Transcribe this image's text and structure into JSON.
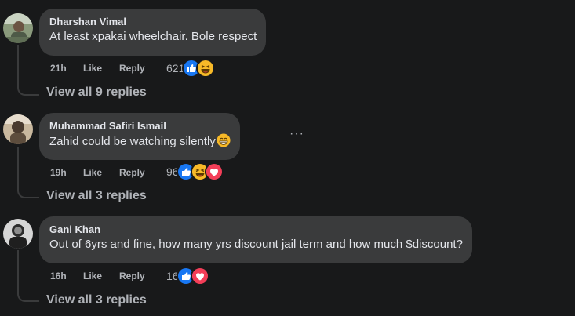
{
  "comments": [
    {
      "author": "Dharshan Vimal",
      "text": "At least xpakai wheelchair. Bole respect",
      "time": "21h",
      "like_label": "Like",
      "reply_label": "Reply",
      "reaction_count": "621",
      "reactions": [
        "like",
        "haha"
      ],
      "view_replies": "View all 9 replies"
    },
    {
      "author": "Muhammad Safiri Ismail",
      "text": "Zahid could be watching silently",
      "text_emoji": "grin",
      "more_label": "···",
      "time": "19h",
      "like_label": "Like",
      "reply_label": "Reply",
      "reaction_count": "96",
      "reactions": [
        "like",
        "haha",
        "love"
      ],
      "view_replies": "View all 3 replies"
    },
    {
      "author": "Gani Khan",
      "text": "Out of 6yrs and fine, how many yrs discount jail term and how much $discount?",
      "time": "16h",
      "like_label": "Like",
      "reply_label": "Reply",
      "reaction_count": "16",
      "reactions": [
        "like",
        "love"
      ],
      "view_replies": "View all 3 replies"
    }
  ],
  "colors": {
    "background": "#18191a",
    "bubble": "#3a3b3c",
    "primary_text": "#e4e6eb",
    "secondary_text": "#b0b3b8",
    "like_blue": "#1877f2",
    "love_red": "#f33e58",
    "haha_yellow": "#f7b928"
  }
}
